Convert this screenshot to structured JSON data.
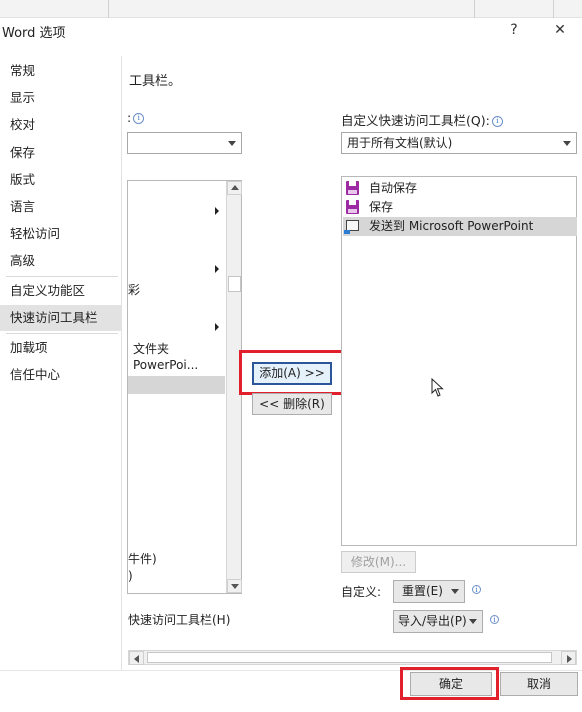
{
  "window": {
    "title": "Word 选项",
    "help": "?",
    "close": "✕"
  },
  "sidebar": {
    "items": [
      {
        "label": "常规"
      },
      {
        "label": "显示"
      },
      {
        "label": "校对"
      },
      {
        "label": "保存"
      },
      {
        "label": "版式"
      },
      {
        "label": "语言"
      },
      {
        "label": "轻松访问"
      },
      {
        "label": "高级"
      },
      {
        "label": "自定义功能区"
      },
      {
        "label": "快速访问工具栏",
        "selected": true
      },
      {
        "label": "加载项"
      },
      {
        "label": "信任中心"
      }
    ]
  },
  "main": {
    "heading": "工具栏。",
    "left_label": ":",
    "left_list": {
      "items": [
        "彩",
        "文件夹",
        "PowerPoi..."
      ],
      "bottom_items": [
        "牛件)",
        ")"
      ]
    },
    "left_bottom_label": "快速访问工具栏(H)",
    "right_label": "自定义快速访问工具栏(Q):",
    "right_dropdown": "用于所有文档(默认)",
    "quick_list": [
      {
        "label": "自动保存",
        "icon": "save-icon"
      },
      {
        "label": "保存",
        "icon": "save-icon"
      },
      {
        "label": "发送到 Microsoft PowerPoint",
        "icon": "send-to-powerpoint-icon",
        "selected": true
      }
    ],
    "add_button": "添加(A) >>",
    "remove_button": "<< 删除(R)",
    "modify_button": "修改(M)...",
    "customize_label": "自定义:",
    "reset_button": "重置(E)",
    "import_export_button": "导入/导出(P)"
  },
  "footer": {
    "ok": "确定",
    "cancel": "取消"
  },
  "colors": {
    "highlight": "#e0202a",
    "accent": "#2b579a",
    "save_icon": "#9b2aa3"
  }
}
